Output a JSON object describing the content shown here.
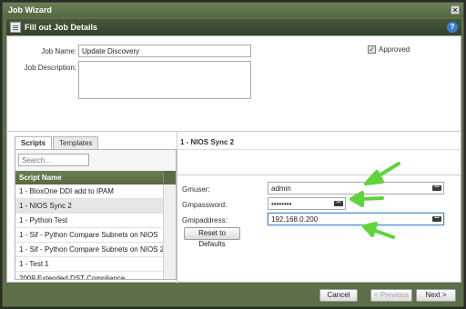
{
  "window": {
    "title": "Job Wizard",
    "close_label": "×"
  },
  "subheader": {
    "title": "Fill out Job Details",
    "help_label": "?"
  },
  "form": {
    "job_name_label": "Job Name:",
    "job_name_value": "Update Discovery",
    "job_description_label": "Job Description:",
    "job_description_value": "",
    "approved_label": "Approved",
    "approved_checked": true,
    "approved_mark": "✓"
  },
  "scripts_panel": {
    "tabs": [
      {
        "label": "Scripts",
        "active": true
      },
      {
        "label": "Templates",
        "active": false
      }
    ],
    "search_placeholder": "Search...",
    "column_header": "Script Name",
    "rows": [
      {
        "label": "1 - BloxOne DDI add to IPAM",
        "selected": false
      },
      {
        "label": "1 - NIOS Sync 2",
        "selected": true
      },
      {
        "label": "1 - Python Test",
        "selected": false
      },
      {
        "label": "1 - Sif - Python Compare Subnets on NIOS",
        "selected": false
      },
      {
        "label": "1 - Sif - Python Compare Subnets on NIOS 2",
        "selected": false
      },
      {
        "label": "1 - Test 1",
        "selected": false
      },
      {
        "label": "2009 Extended DST Compliance",
        "selected": false
      }
    ]
  },
  "script_params": {
    "title": "1 - NIOS Sync 2",
    "fields": [
      {
        "label": "Gmuser:",
        "value": "admin"
      },
      {
        "label": "Gmpassword:",
        "value": "••••••••"
      },
      {
        "label": "Gmipaddress:",
        "value": "192.168.0.200"
      }
    ],
    "reset_label": "Reset to Defaults",
    "dots_glyph": "•••"
  },
  "footer": {
    "cancel_label": "Cancel",
    "previous_label": "< Previous",
    "next_label": "Next >"
  },
  "colors": {
    "titlebar": "#5c6f48",
    "header_green": "#6b7f55",
    "arrow_green": "#5fd43a",
    "focus_blue": "#4a86c8"
  }
}
